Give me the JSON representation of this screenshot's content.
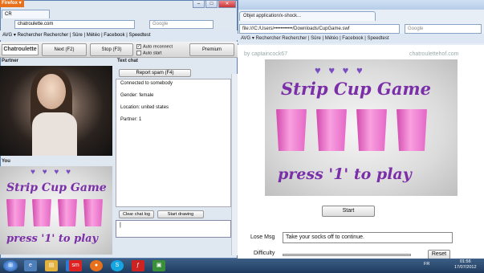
{
  "right_window": {
    "tab_title": "Objet application/x-shock...",
    "url": "file:///C:/Users/•••••••••••/Downloads/CupGame.swf",
    "search_placeholder": "Google",
    "bookmarks": "AVG ▾  Rechercher   Rechercher  |  Sûre  |  Météo  |  Facebook  |  Speedtest",
    "credit_left": "by captaincock67",
    "credit_right": "chatroulettehof.com",
    "game": {
      "hearts": "♥ ♥ ♥ ♥",
      "title": "Strip Cup Game",
      "press": "press '1' to play",
      "cup_count": 4
    },
    "start_label": "Start",
    "lose_msg_label": "Lose Msg",
    "lose_msg_value": "Take your socks off to continue.",
    "difficulty_label": "Difficulty",
    "reset_label": "Reset"
  },
  "left_window": {
    "firefox_button": "Firefox ▾",
    "tab_title": "CR",
    "url": "chatroulette.com",
    "search_placeholder": "Google",
    "bookmarks": "AVG ▾  Rechercher   Rechercher  |  Sûre  |  Météo  |  Facebook  |  Speedtest",
    "logo": "Chatroulette",
    "next_label": "Next (F2)",
    "stop_label": "Stop (F3)",
    "auto_reconnect": "Auto reconnect",
    "auto_start": "Auto start",
    "premium_label": "Premium",
    "partner_label": "Partner",
    "you_label": "You",
    "text_chat_label": "Text chat",
    "report_spam": "Report spam (F4)",
    "chat_lines": [
      "Connected to somebody",
      "Gender: female",
      "Location: united states",
      "Partner: 1"
    ],
    "clear_chat": "Clear chat log",
    "start_drawing": "Start drawing",
    "message_value": "|",
    "game": {
      "hearts": "♥ ♥ ♥ ♥",
      "title": "Strip Cup Game",
      "press": "press '1' to play"
    }
  },
  "taskbar": {
    "start_icon": "windows-start-icon",
    "icons": [
      "explorer-icon",
      "folder-icon",
      "media-icon",
      "sm-app-icon",
      "firefox-icon",
      "skype-icon",
      "flash-icon",
      "app-icon"
    ],
    "lang": "FR",
    "time": "01:56",
    "date": "17/07/2012"
  },
  "colors": {
    "game_purple": "#7a2ea8",
    "cup_pink": "#e467c6",
    "heart": "#7a4ec0",
    "firefox_orange": "#e8701a"
  }
}
